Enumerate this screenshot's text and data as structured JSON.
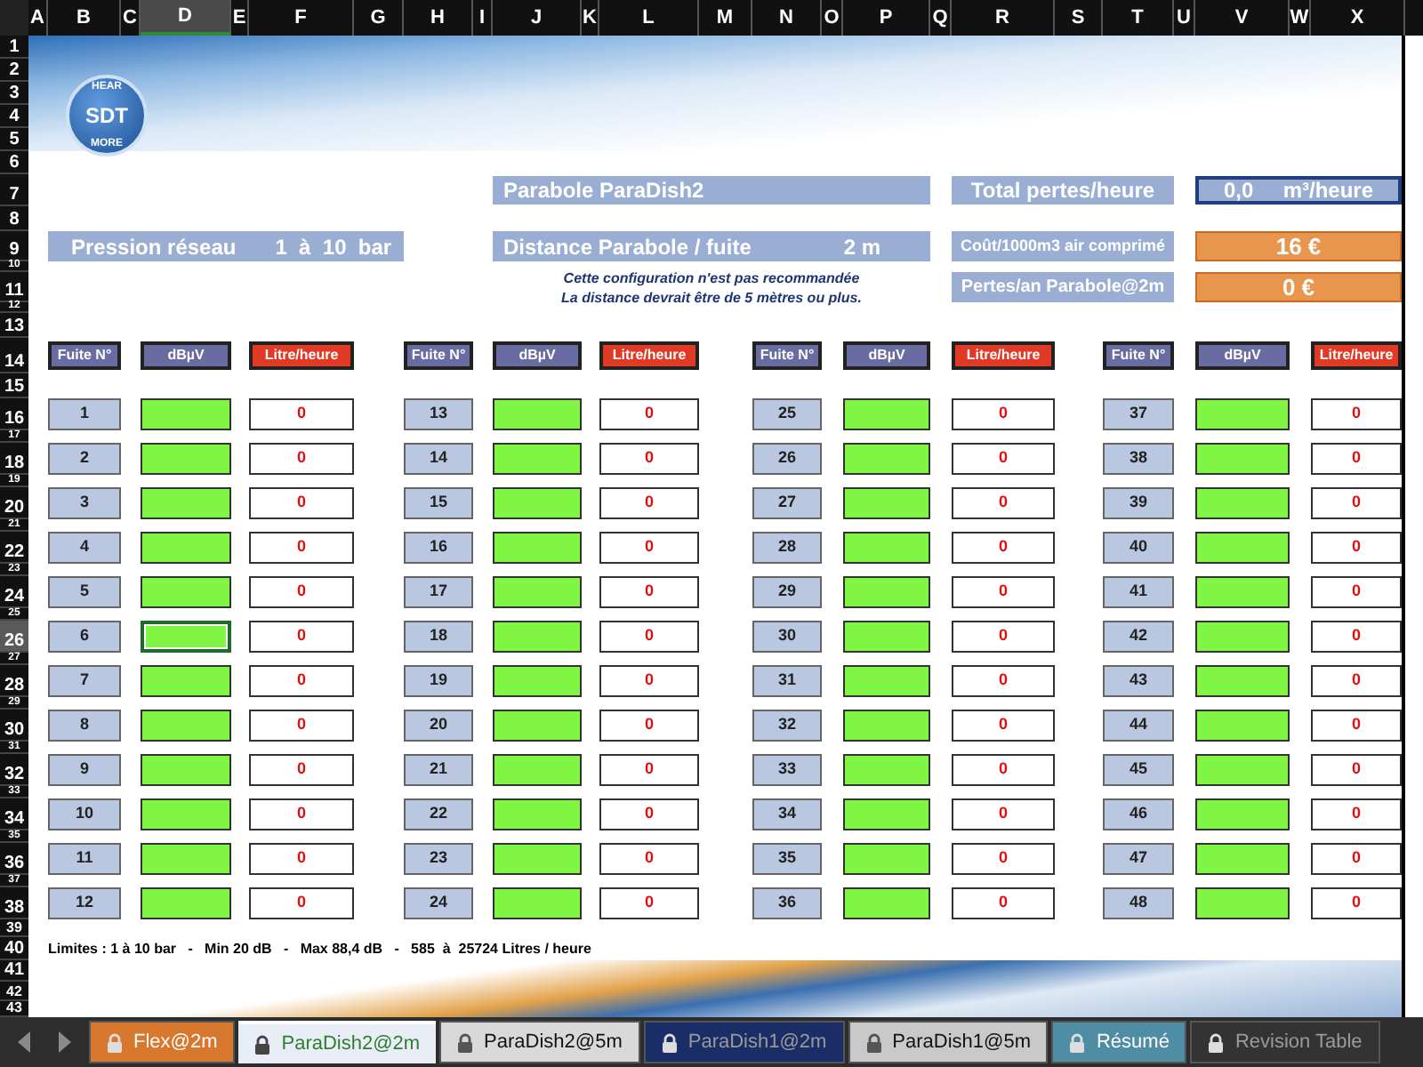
{
  "column_headers": [
    "A",
    "B",
    "C",
    "D",
    "E",
    "F",
    "G",
    "H",
    "I",
    "J",
    "K",
    "L",
    "M",
    "N",
    "O",
    "P",
    "Q",
    "R",
    "S",
    "T",
    "U",
    "V",
    "W",
    "X"
  ],
  "row_headers": [
    "1",
    "2",
    "3",
    "4",
    "5",
    "6",
    "7",
    "8",
    "9",
    "10",
    "11",
    "12",
    "13",
    "14",
    "15",
    "16",
    "17",
    "18",
    "19",
    "20",
    "21",
    "22",
    "23",
    "24",
    "25",
    "26",
    "27",
    "28",
    "29",
    "30",
    "31",
    "32",
    "33",
    "34",
    "35",
    "36",
    "37",
    "38",
    "39",
    "40",
    "41",
    "42",
    "43"
  ],
  "logo": {
    "top": "HEAR",
    "center": "SDT",
    "bottom": "MORE"
  },
  "info": {
    "parabole": "Parabole ParaDish2",
    "total_label": "Total pertes/heure",
    "total_value": "0,0",
    "total_unit": "m³/heure",
    "pression_label": "Pression réseau",
    "pression_range": "1  à  10  bar",
    "distance_label": "Distance Parabole / fuite",
    "distance_value": "2 m",
    "cost_label": "Coût/1000m3 air comprimé",
    "cost_value": "16 €",
    "loss_label": "Pertes/an Parabole@2m",
    "loss_value": "0 €",
    "warning": [
      "Cette configuration n'est pas recommandée",
      "La distance devrait être de 5 mètres ou plus."
    ]
  },
  "groups": [
    {
      "headers": [
        "Fuite N°",
        "dBµV",
        "Litre/heure"
      ],
      "leaks": [
        {
          "number": "1",
          "litres": "0",
          "selected": false
        },
        {
          "number": "2",
          "litres": "0",
          "selected": false
        },
        {
          "number": "3",
          "litres": "0",
          "selected": false
        },
        {
          "number": "4",
          "litres": "0",
          "selected": false
        },
        {
          "number": "5",
          "litres": "0",
          "selected": false
        },
        {
          "number": "6",
          "litres": "0",
          "selected": true
        },
        {
          "number": "7",
          "litres": "0",
          "selected": false
        },
        {
          "number": "8",
          "litres": "0",
          "selected": false
        },
        {
          "number": "9",
          "litres": "0",
          "selected": false
        },
        {
          "number": "10",
          "litres": "0",
          "selected": false
        },
        {
          "number": "11",
          "litres": "0",
          "selected": false
        },
        {
          "number": "12",
          "litres": "0",
          "selected": false
        }
      ]
    },
    {
      "headers": [
        "Fuite N°",
        "dBµV",
        "Litre/heure"
      ],
      "leaks": [
        {
          "number": "13",
          "litres": "0",
          "selected": false
        },
        {
          "number": "14",
          "litres": "0",
          "selected": false
        },
        {
          "number": "15",
          "litres": "0",
          "selected": false
        },
        {
          "number": "16",
          "litres": "0",
          "selected": false
        },
        {
          "number": "17",
          "litres": "0",
          "selected": false
        },
        {
          "number": "18",
          "litres": "0",
          "selected": false
        },
        {
          "number": "19",
          "litres": "0",
          "selected": false
        },
        {
          "number": "20",
          "litres": "0",
          "selected": false
        },
        {
          "number": "21",
          "litres": "0",
          "selected": false
        },
        {
          "number": "22",
          "litres": "0",
          "selected": false
        },
        {
          "number": "23",
          "litres": "0",
          "selected": false
        },
        {
          "number": "24",
          "litres": "0",
          "selected": false
        }
      ]
    },
    {
      "headers": [
        "Fuite N°",
        "dBµV",
        "Litre/heure"
      ],
      "leaks": [
        {
          "number": "25",
          "litres": "0",
          "selected": false
        },
        {
          "number": "26",
          "litres": "0",
          "selected": false
        },
        {
          "number": "27",
          "litres": "0",
          "selected": false
        },
        {
          "number": "28",
          "litres": "0",
          "selected": false
        },
        {
          "number": "29",
          "litres": "0",
          "selected": false
        },
        {
          "number": "30",
          "litres": "0",
          "selected": false
        },
        {
          "number": "31",
          "litres": "0",
          "selected": false
        },
        {
          "number": "32",
          "litres": "0",
          "selected": false
        },
        {
          "number": "33",
          "litres": "0",
          "selected": false
        },
        {
          "number": "34",
          "litres": "0",
          "selected": false
        },
        {
          "number": "35",
          "litres": "0",
          "selected": false
        },
        {
          "number": "36",
          "litres": "0",
          "selected": false
        }
      ]
    },
    {
      "headers": [
        "Fuite N°",
        "dBµV",
        "Litre/heure"
      ],
      "leaks": [
        {
          "number": "37",
          "litres": "0",
          "selected": false
        },
        {
          "number": "38",
          "litres": "0",
          "selected": false
        },
        {
          "number": "39",
          "litres": "0",
          "selected": false
        },
        {
          "number": "40",
          "litres": "0",
          "selected": false
        },
        {
          "number": "41",
          "litres": "0",
          "selected": false
        },
        {
          "number": "42",
          "litres": "0",
          "selected": false
        },
        {
          "number": "43",
          "litres": "0",
          "selected": false
        },
        {
          "number": "44",
          "litres": "0",
          "selected": false
        },
        {
          "number": "45",
          "litres": "0",
          "selected": false
        },
        {
          "number": "46",
          "litres": "0",
          "selected": false
        },
        {
          "number": "47",
          "litres": "0",
          "selected": false
        },
        {
          "number": "48",
          "litres": "0",
          "selected": false
        }
      ]
    }
  ],
  "limits": "Limites : 1 à 10 bar   -   Min 20 dB   -   Max 88,4 dB   -   585  à  25724 Litres / heure",
  "sheet_tabs": [
    {
      "label": "Flex@2m",
      "selected": false,
      "locked": true,
      "color": "#d8772e"
    },
    {
      "label": "ParaDish2@2m",
      "selected": true,
      "locked": true,
      "color": "#e9eef6"
    },
    {
      "label": "ParaDish2@5m",
      "selected": false,
      "locked": true,
      "color": "#d9d9d9"
    },
    {
      "label": "ParaDish1@2m",
      "selected": false,
      "locked": true,
      "color": "#1b2d66"
    },
    {
      "label": "ParaDish1@5m",
      "selected": false,
      "locked": true,
      "color": "#c9c9c9"
    },
    {
      "label": "Résumé",
      "selected": false,
      "locked": true,
      "color": "#4e8da3"
    },
    {
      "label": "Revision Table",
      "selected": false,
      "locked": true,
      "color": "#333333"
    }
  ]
}
